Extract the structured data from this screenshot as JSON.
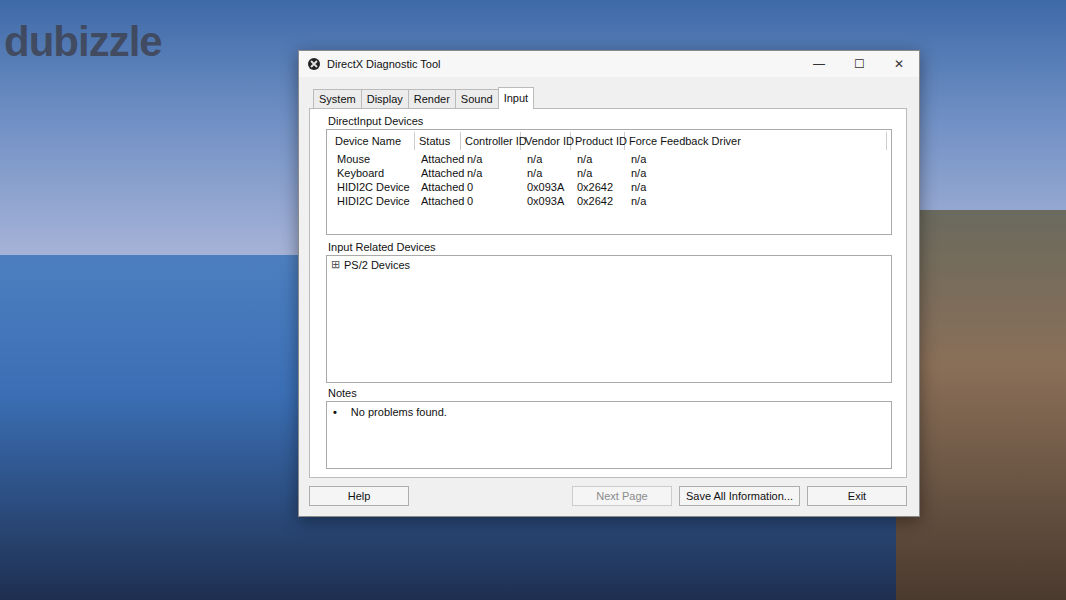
{
  "watermark": "dubizzle",
  "window": {
    "title": "DirectX Diagnostic Tool",
    "controls": [
      "—",
      "☐",
      "✕"
    ]
  },
  "tabs": [
    {
      "label": "System",
      "selected": false
    },
    {
      "label": "Display",
      "selected": false
    },
    {
      "label": "Render",
      "selected": false
    },
    {
      "label": "Sound",
      "selected": false
    },
    {
      "label": "Input",
      "selected": true
    }
  ],
  "directinput": {
    "label": "DirectInput Devices",
    "columns": [
      "Device Name",
      "Status",
      "Controller ID",
      "Vendor ID",
      "Product ID",
      "Force Feedback Driver"
    ],
    "rows": [
      [
        "Mouse",
        "Attached",
        "n/a",
        "n/a",
        "n/a",
        "n/a"
      ],
      [
        "Keyboard",
        "Attached",
        "n/a",
        "n/a",
        "n/a",
        "n/a"
      ],
      [
        "HIDI2C Device",
        "Attached",
        "0",
        "0x093A",
        "0x2642",
        "n/a"
      ],
      [
        "HIDI2C Device",
        "Attached",
        "0",
        "0x093A",
        "0x2642",
        "n/a"
      ]
    ]
  },
  "related": {
    "label": "Input Related Devices",
    "items": [
      {
        "label": "PS/2 Devices",
        "expand_icon": "⊞",
        "expanded": false
      }
    ]
  },
  "notes": {
    "label": "Notes",
    "items": [
      {
        "bullet": "•",
        "text": "No problems found."
      }
    ]
  },
  "buttons": [
    {
      "label": "Help",
      "disabled": false
    },
    {
      "label": "Next Page",
      "disabled": true
    },
    {
      "label": "Save All Information...",
      "disabled": false
    },
    {
      "label": "Exit",
      "disabled": false
    }
  ]
}
